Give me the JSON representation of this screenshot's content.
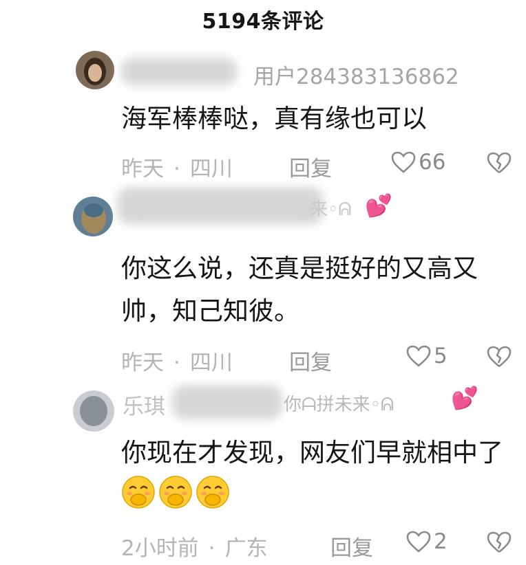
{
  "header": {
    "title": "5194条评论"
  },
  "comments": [
    {
      "username": "用户284383136862",
      "username_suffix": "",
      "text": "海军棒棒哒，真有缘也可以",
      "time": "昨天",
      "location": "四川",
      "reply_label": "回复",
      "likes": "66"
    },
    {
      "username": "",
      "username_suffix": "来◦ᕱ",
      "text": "你这么说，还真是挺好的又高又帅，知己知彼。",
      "time": "昨天",
      "location": "四川",
      "reply_label": "回复",
      "likes": "5"
    },
    {
      "username": "乐琪",
      "username_suffix": "你ᗩ拼未来◦ᕱ",
      "text": "你现在才发现，网友们早就相中了",
      "time": "2小时前",
      "location": "广东",
      "reply_label": "回复",
      "likes": "2",
      "emoji_count": 3
    }
  ],
  "colors": {
    "meta_gray": "#b4b4b4",
    "username_gray": "#a5a5a5",
    "heart_pink": "#ff8fb8"
  }
}
